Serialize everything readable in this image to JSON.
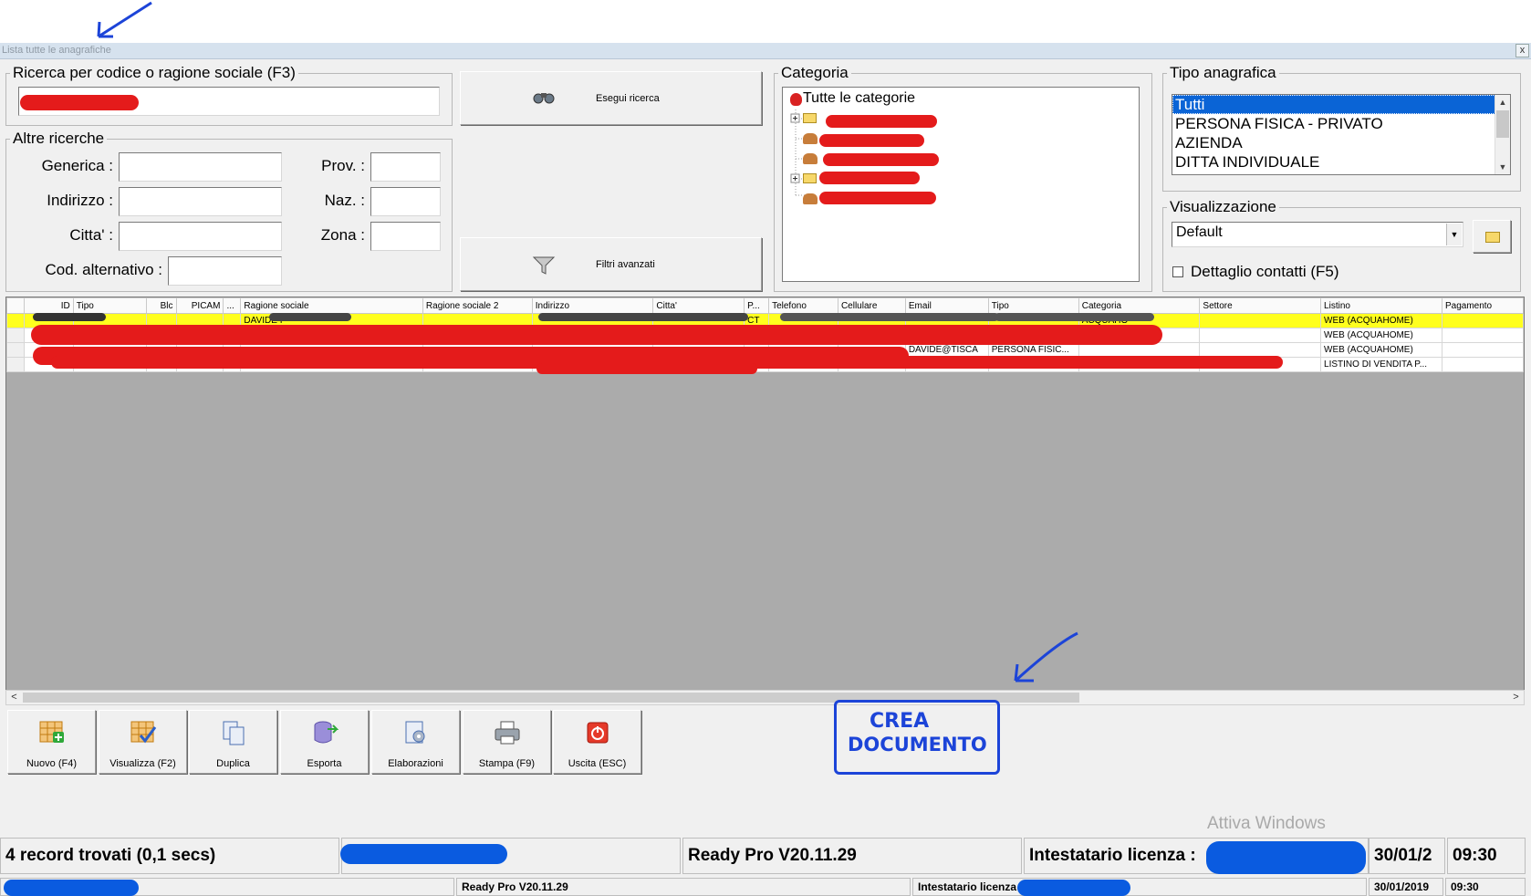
{
  "window": {
    "title": "Lista tutte le anagrafiche",
    "close_label": "x"
  },
  "search": {
    "legend": "Ricerca per codice o ragione sociale (F3)",
    "value": ""
  },
  "other_search": {
    "legend": "Altre ricerche",
    "generica_label": "Generica :",
    "indirizzo_label": "Indirizzo :",
    "citta_label": "Citta' :",
    "prov_label": "Prov. :",
    "naz_label": "Naz. :",
    "zona_label": "Zona :",
    "cod_alt_label": "Cod. alternativo :"
  },
  "buttons": {
    "esegui_ricerca": "Esegui ricerca",
    "filtri_avanzati": "Filtri avanzati"
  },
  "categoria": {
    "legend": "Categoria",
    "root": "Tutte le categorie"
  },
  "tipo_anagrafica": {
    "legend": "Tipo anagrafica",
    "items": [
      "Tutti",
      "PERSONA FISICA - PRIVATO",
      "AZIENDA",
      "DITTA INDIVIDUALE"
    ]
  },
  "visualizzazione": {
    "legend": "Visualizzazione",
    "selected": "Default",
    "dettaglio_contatti": "Dettaglio contatti (F5)"
  },
  "grid": {
    "columns": [
      "ID",
      "Tipo",
      "Blc",
      "PICAM",
      "...",
      "Ragione sociale",
      "Ragione sociale 2",
      "Indirizzo",
      "Citta'",
      "P...",
      "Telefono",
      "Cellulare",
      "Email",
      "Tipo",
      "Categoria",
      "Settore",
      "Listino",
      "Pagamento"
    ],
    "rows": [
      {
        "ragione": "DAVIDE I",
        "prov": "CT",
        "categoria": "ACQUAHO",
        "listino": "WEB (ACQUAHOME)"
      },
      {
        "ragione": "",
        "prov": "",
        "categoria": "",
        "listino": "WEB (ACQUAHOME)"
      },
      {
        "ragione": "",
        "prov": "",
        "email": "DAVIDE@TISCA",
        "tipo": "PERSONA FISIC...",
        "categoria": "",
        "listino": "WEB (ACQUAHOME)"
      },
      {
        "ragione": "",
        "prov": "",
        "categoria": "",
        "listino": "LISTINO DI VENDITA P..."
      }
    ]
  },
  "toolbar": [
    "Nuovo (F4)",
    "Visualizza (F2)",
    "Duplica",
    "Esporta",
    "Elaborazioni",
    "Stampa (F9)",
    "Uscita (ESC)"
  ],
  "annotation": {
    "line1": "CREA",
    "line2": "DOCUMENTO"
  },
  "watermark": "Attiva Windows",
  "status": {
    "records": "4 record trovati (0,1 secs)",
    "version": "Ready Pro V20.11.29",
    "licensee_label": "Intestatario licenza :",
    "date_short": "30/01/2",
    "time": "09:30",
    "version_small": "Ready Pro V20.11.29",
    "licensee_small": "Intestatario licenza",
    "date": "30/01/2019",
    "time_small": "09:30"
  }
}
